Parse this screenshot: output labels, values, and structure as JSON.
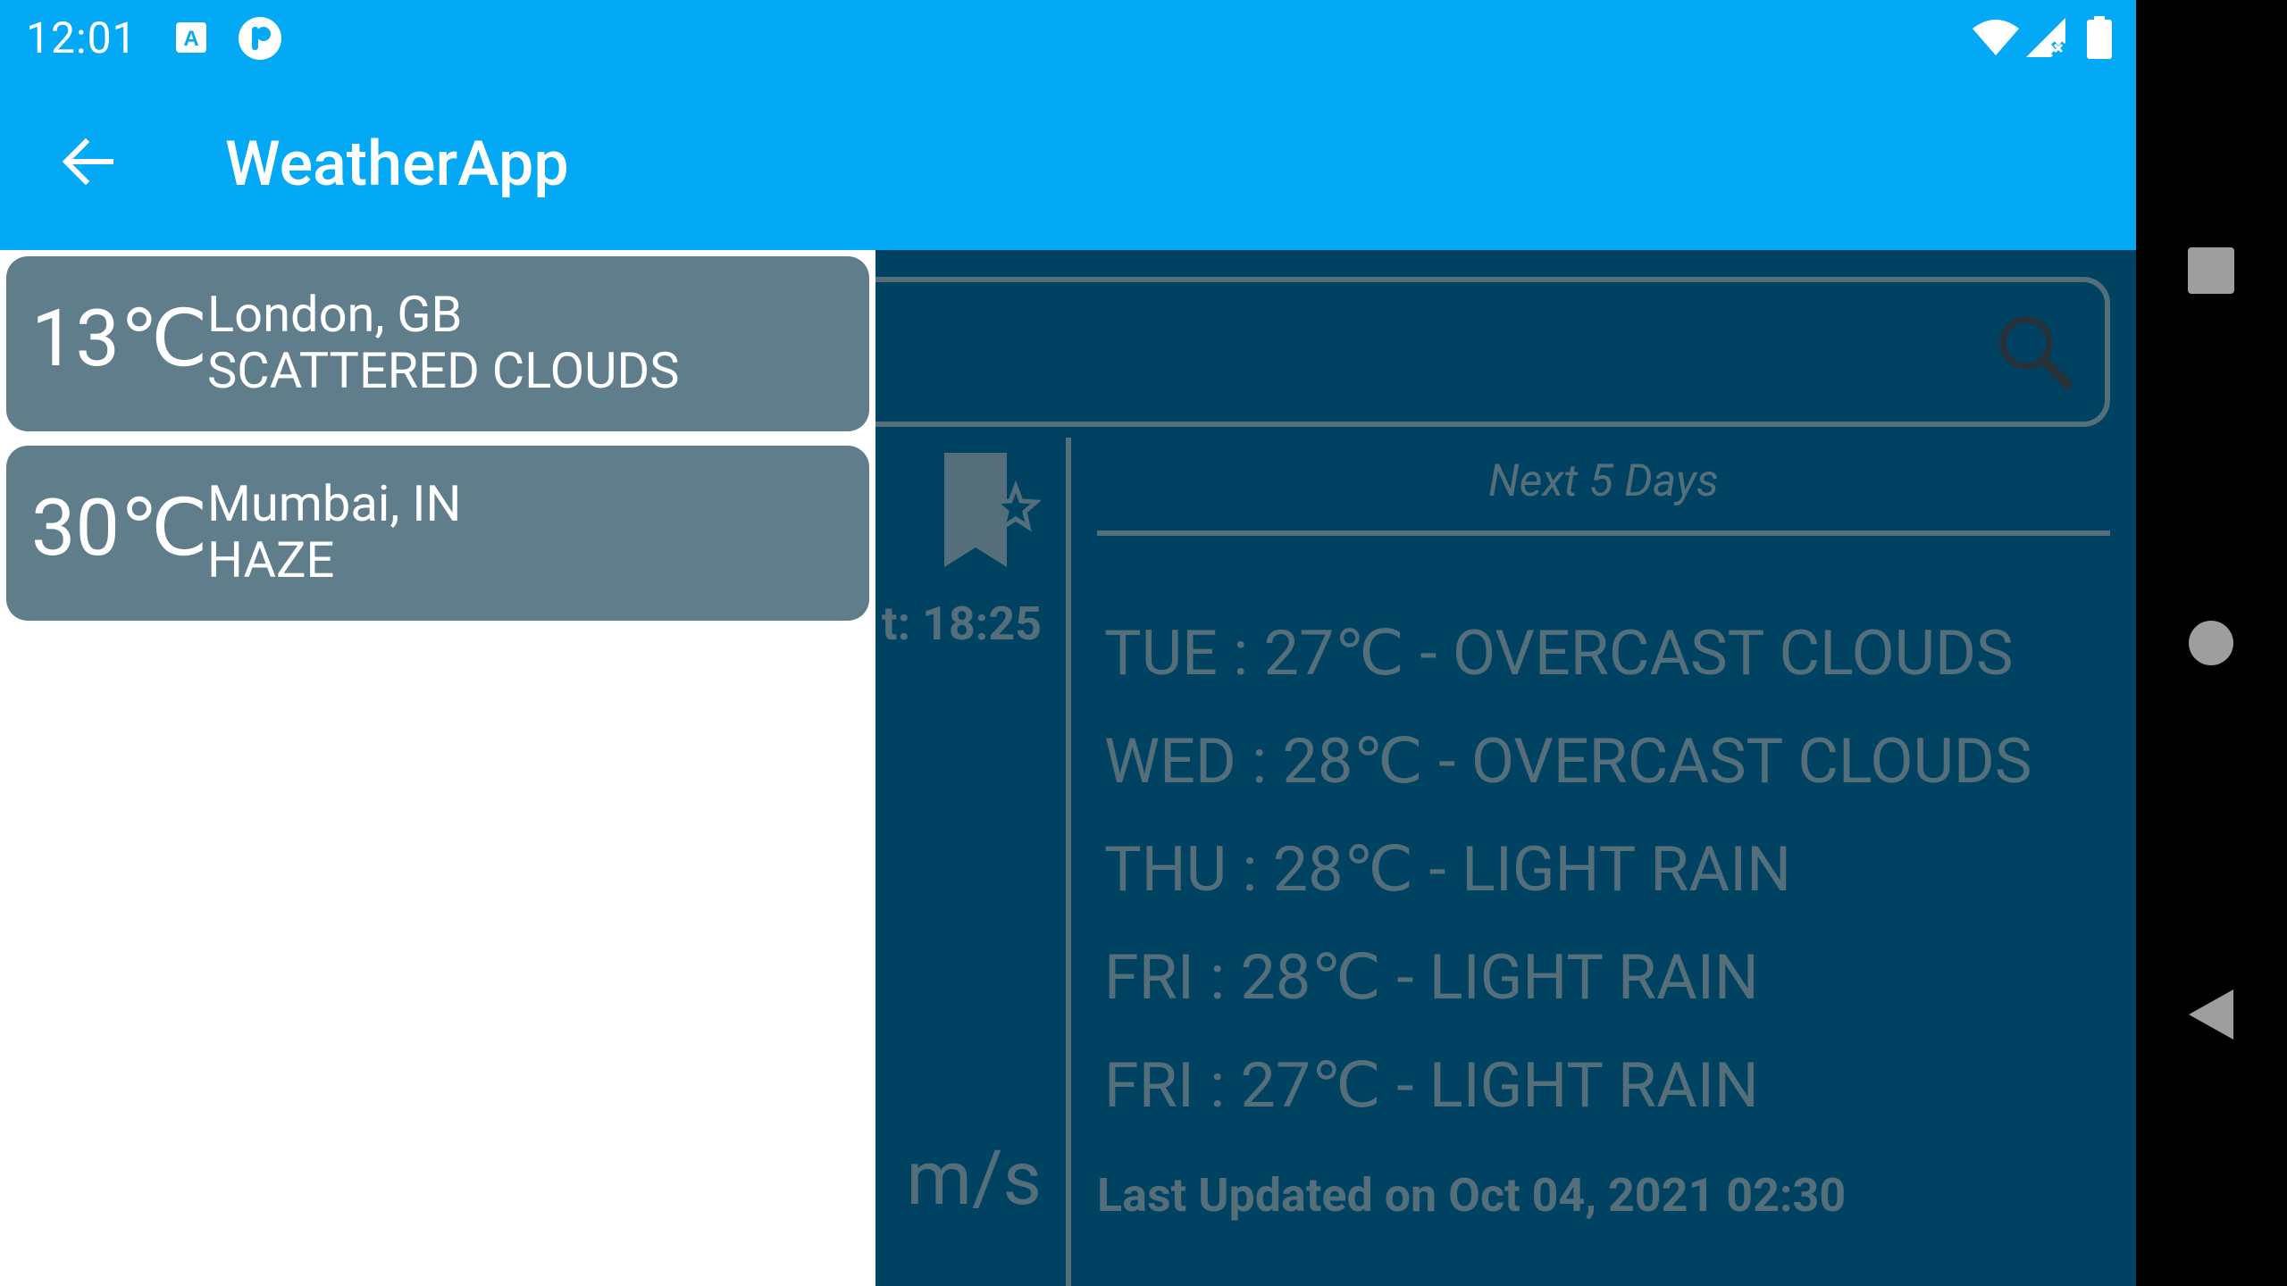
{
  "status_bar": {
    "time": "12:01",
    "icons": [
      "text-a-icon",
      "pocket-p-icon",
      "wifi-icon",
      "signal-icon",
      "battery-icon"
    ]
  },
  "toolbar": {
    "title": "WeatherApp",
    "back_icon": "arrow-back-icon"
  },
  "colors": {
    "accent": "#03a9f4",
    "card": "#607d8b",
    "dim_background": "#004261",
    "dim_text": "#546e7a"
  },
  "main": {
    "search_icon": "search-icon",
    "bookmark_icon": "bookmark-star-icon",
    "sunset_partial": "t: 18:25",
    "wind_unit": "m/s",
    "forecast_title": "Next 5 Days",
    "forecast": [
      "TUE : 27℃ - OVERCAST CLOUDS",
      "WED : 28℃ - OVERCAST CLOUDS",
      "THU : 28℃ - LIGHT RAIN",
      "FRI : 28℃ - LIGHT RAIN",
      "FRI : 27℃ - LIGHT RAIN"
    ],
    "last_updated": "Last Updated on Oct 04, 2021 02:30"
  },
  "saved_cities": [
    {
      "temp": "13℃",
      "name": "London, GB",
      "description": "SCATTERED CLOUDS"
    },
    {
      "temp": "30℃",
      "name": "Mumbai, IN",
      "description": "HAZE"
    }
  ],
  "nav_bar": {
    "icons": [
      "recents-icon",
      "home-icon",
      "back-triangle-icon"
    ]
  }
}
